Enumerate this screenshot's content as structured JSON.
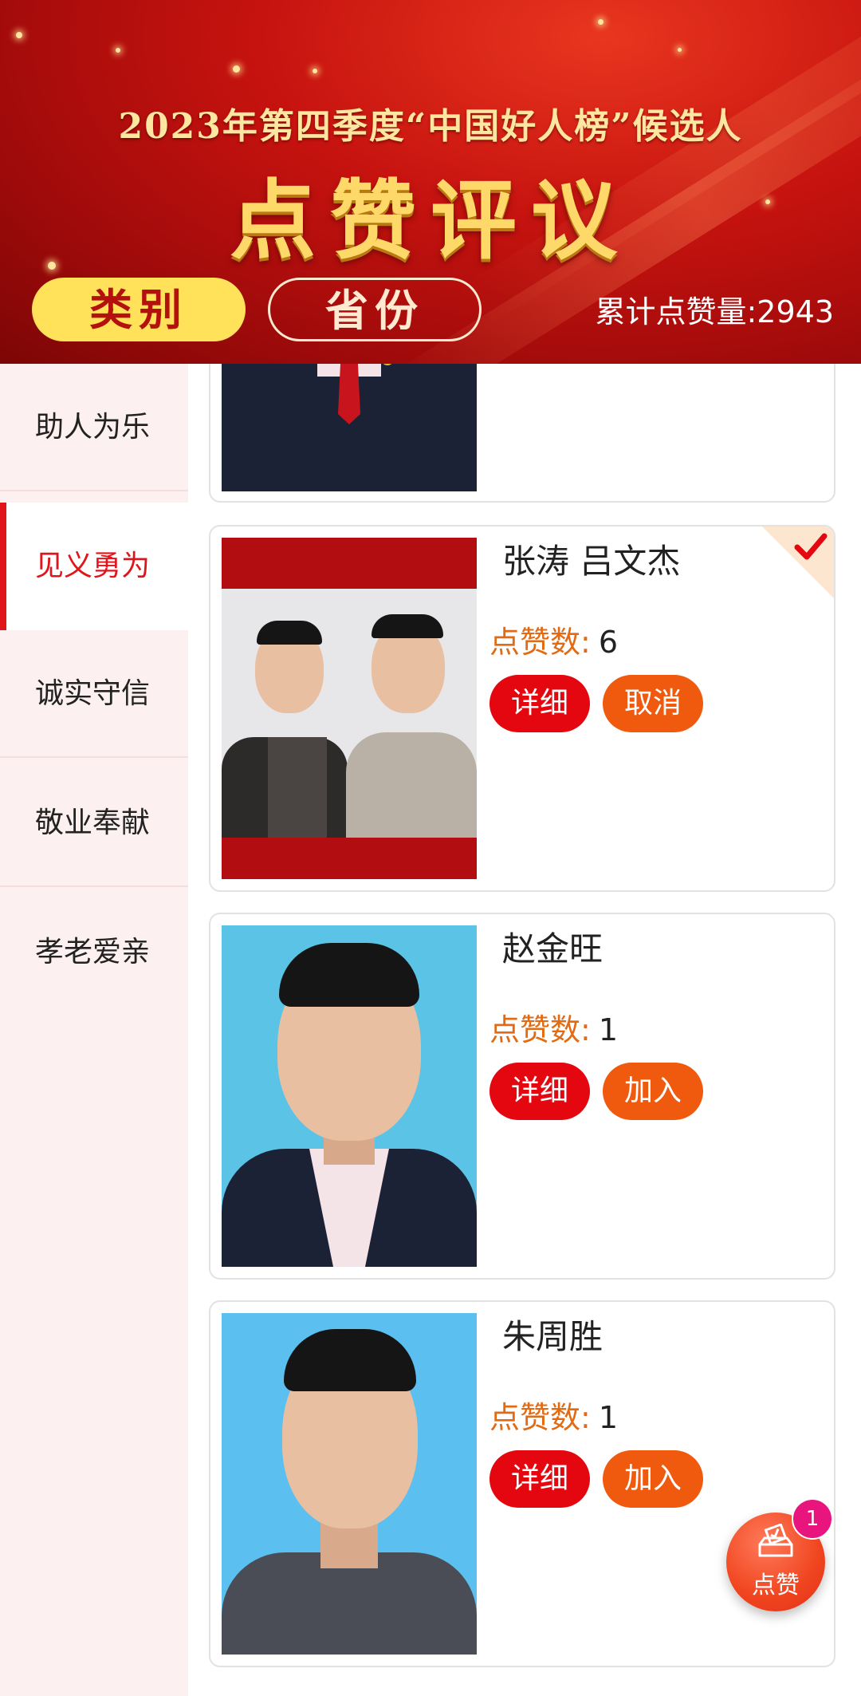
{
  "header": {
    "subtitle": "2023年第四季度“中国好人榜”候选人",
    "title": "点赞评议",
    "tabs": {
      "category": "类别",
      "province": "省份"
    },
    "total_likes": "累计点赞量:2943"
  },
  "sidebar": {
    "items": [
      {
        "label": "助人为乐",
        "active": false
      },
      {
        "label": "见义勇为",
        "active": true
      },
      {
        "label": "诚实守信",
        "active": false
      },
      {
        "label": "敬业奉献",
        "active": false
      },
      {
        "label": "孝老爱亲",
        "active": false
      }
    ]
  },
  "cards": [
    {
      "name": "张涛   吕文杰",
      "likes_label": "点赞数:",
      "likes": "6",
      "detail": "详细",
      "action": "取消",
      "selected": true
    },
    {
      "name": "赵金旺",
      "likes_label": "点赞数:",
      "likes": "1",
      "detail": "详细",
      "action": "加入",
      "selected": false
    },
    {
      "name": "朱周胜",
      "likes_label": "点赞数:",
      "likes": "1",
      "detail": "详细",
      "action": "加入",
      "selected": false
    }
  ],
  "float_button": {
    "label": "点赞",
    "badge": "1"
  },
  "colors": {
    "primary_red": "#e4070f",
    "accent_orange": "#f05a0e",
    "gold": "#ffd86a",
    "tab_yellow": "#ffe25a"
  },
  "icons": [
    "check-icon",
    "vote-box-icon"
  ]
}
